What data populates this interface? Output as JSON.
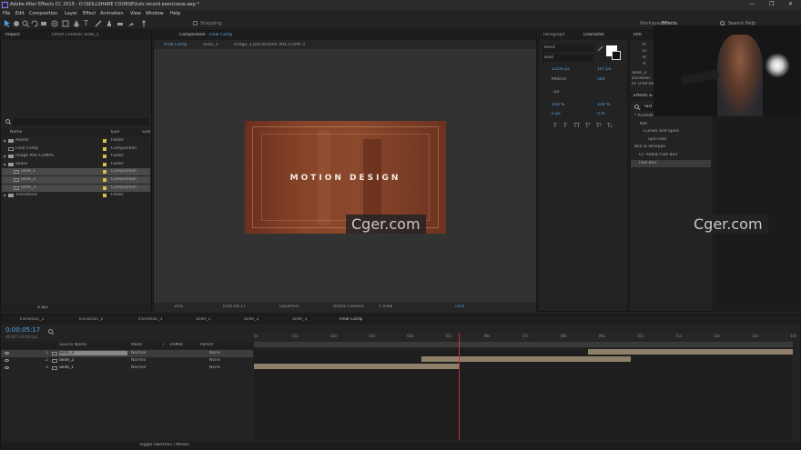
{
  "title_bar": {
    "title": "Adobe After Effects CC 2015 - D:\\SKILLSHARE COURSE\\tuts record exercisese.aep *",
    "minimize": "—",
    "maximize": "❐",
    "close": "✕"
  },
  "menu": [
    "File",
    "Edit",
    "Composition",
    "Layer",
    "Effect",
    "Animation",
    "View",
    "Window",
    "Help"
  ],
  "toolbar": {
    "snapping": "Snapping",
    "workspace_label": "Workspace:",
    "workspace_value": "Effects",
    "search_help": "Search Help"
  },
  "project_panel": {
    "tab_project": "Project",
    "tab_effect_controls": "Effect Controls Slide_1",
    "col_name": "Name",
    "col_type": "Type",
    "col_size": "Size",
    "bpc": "8 bpc",
    "items": [
      {
        "name": "Assets",
        "type": "Folder",
        "indent": 0,
        "highlight": false
      },
      {
        "name": "Final Comp",
        "type": "Composition",
        "indent": 0,
        "highlight": false
      },
      {
        "name": "Image PRE-COMPS",
        "type": "Folder",
        "indent": 0,
        "highlight": false
      },
      {
        "name": "Slides",
        "type": "Folder",
        "indent": 0,
        "highlight": false
      },
      {
        "name": "Slide_1",
        "type": "Composition",
        "indent": 1,
        "highlight": true
      },
      {
        "name": "Slide_2",
        "type": "Composition",
        "indent": 1,
        "highlight": true
      },
      {
        "name": "Slide_3",
        "type": "Composition",
        "indent": 1,
        "highlight": true
      },
      {
        "name": "Transitions",
        "type": "Folder",
        "indent": 0,
        "highlight": false
      }
    ]
  },
  "comp_panel": {
    "tab_title": "Composition",
    "tab_comp_name": "Final Comp",
    "breadcrumbs": [
      "Final Comp",
      "Slide_3",
      "Image_3 placeholder PRE-COMP 3"
    ],
    "canvas_text": "MOTION DESIGN",
    "zoom": "25%",
    "timecode": "0:00:05:17",
    "resolution": "(Quarter)",
    "camera": "Active Camera",
    "views": "1 View",
    "exposure": "+0.0"
  },
  "paragraph_panel": {
    "tab": "Paragraph"
  },
  "character_panel": {
    "tab": "Character",
    "font": "Kanit",
    "style": "Bold",
    "size": "125% px",
    "leading": "107 px",
    "kerning": "Metrics",
    "tracking": "500",
    "unit": "- px",
    "vscale": "100 %",
    "hscale": "100 %",
    "baseline": "0 px",
    "tsume": "0 %",
    "text_buttons": [
      "T",
      "T",
      "TT",
      "Tᵀ",
      "T¹",
      "T₁"
    ]
  },
  "info_panel": {
    "tab": "Info",
    "lines": [
      "R:",
      "G:",
      "B:",
      "A:",
      "Slide_3",
      "Duration:",
      "In: 0:00:00"
    ]
  },
  "effects_panel": {
    "tab": "Effects & P",
    "search": "fast",
    "tree": [
      {
        "label": "* Animation Presets",
        "indent": 0
      },
      {
        "label": "Text",
        "indent": 1
      },
      {
        "label": "Curves and Spins",
        "indent": 2
      },
      {
        "label": "Spin Fast",
        "indent": 3
      },
      {
        "label": "Blur & Sharpen",
        "indent": 0
      },
      {
        "label": "CC Radial Fast Blur",
        "indent": 1
      },
      {
        "label": "Fast Blur",
        "indent": 1
      }
    ]
  },
  "watermarks": [
    "Cger.com",
    "Cger.com"
  ],
  "timeline": {
    "tabs": [
      "Transition_1",
      "Transition_2",
      "Transition_3",
      "Slide_1",
      "Slide_2",
      "Slide_3",
      "Final Comp"
    ],
    "timecode": "0:00:05:17",
    "fps": "00167 (30.00 fps)",
    "col_source_name": "Source Name",
    "col_mode": "Mode",
    "col_t": "T",
    "col_trkmat": "TrkMat",
    "col_parent": "Parent",
    "ruler": [
      "0s",
      "01s",
      "02s",
      "03s",
      "04s",
      "05s",
      "06s",
      "07s",
      "08s",
      "09s",
      "10s",
      "11s",
      "12s",
      "13s",
      "14s"
    ],
    "layers": [
      {
        "num": "1",
        "name": "Slide_3",
        "mode": "Normal",
        "parent": "None",
        "bar_start": 0.62,
        "bar_end": 1.0,
        "selected": true
      },
      {
        "num": "2",
        "name": "Slide_2",
        "mode": "Normal",
        "parent": "None",
        "bar_start": 0.31,
        "bar_end": 0.7,
        "selected": false
      },
      {
        "num": "3",
        "name": "Slide_1",
        "mode": "Normal",
        "parent": "None",
        "bar_start": 0.0,
        "bar_end": 0.38,
        "selected": false
      }
    ],
    "playhead_fraction": 0.38,
    "toggle_label": "Toggle Switches / Modes"
  }
}
